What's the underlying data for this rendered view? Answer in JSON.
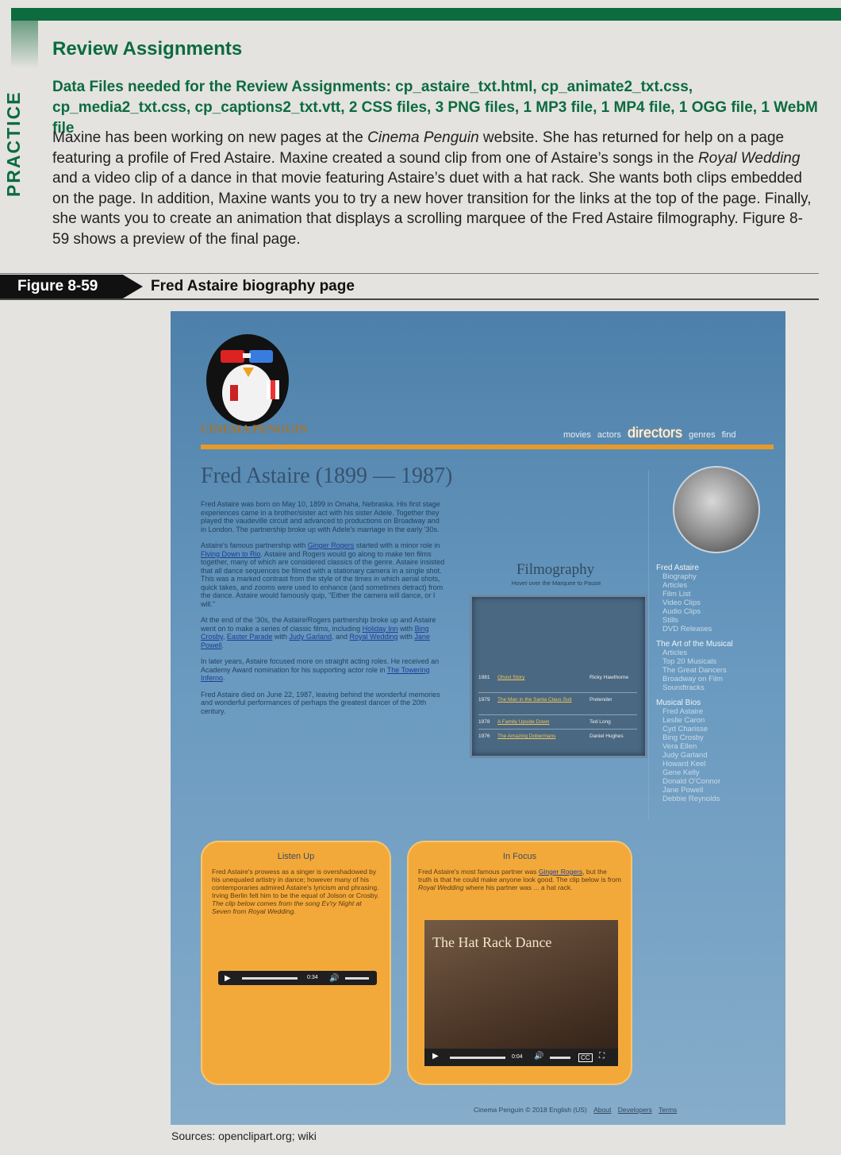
{
  "book": {
    "side_tab": "PRACTICE",
    "title": "Review Assignments",
    "data_files": "Data Files needed for the Review Assignments: cp_astaire_txt.html, cp_animate2_txt.css, cp_media2_txt.css, cp_captions2_txt.vtt, 2 CSS files, 3 PNG files, 1 MP3 file, 1 MP4 file, 1 OGG file, 1 WebM file",
    "para": {
      "p1": "Maxine has been working on new pages at the ",
      "cinema": "Cinema Penguin",
      "p2": " website. She has returned for help on a page featuring a profile of Fred Astaire. Maxine created a sound clip from one of Astaire’s songs in the ",
      "royal": "Royal Wedding",
      "p3": " and a video clip of a dance in that movie featuring Astaire’s duet with a hat rack. She wants both clips embedded on the page. In addition, Maxine wants you to try a new hover transition for the links at the top of the page. Finally, she wants you to create an animation that displays a scrolling marquee of the Fred Astaire filmography. Figure 8-59 shows a preview of the final page."
    },
    "figure_label": "Figure 8-59",
    "figure_caption": "Fred Astaire biography page",
    "sources": "Sources: openclipart.org; wiki"
  },
  "site": {
    "logo_text": "CINEMA PENGUIN",
    "nav": [
      "movies",
      "actors",
      "directors",
      "genres",
      "find"
    ],
    "bio_title": "Fred Astaire (1899 — 1987)",
    "bio": {
      "p1": "Fred Astaire was born on May 10, 1899 in Omaha, Nebraska. His first stage experiences came in a brother/sister act with his sister Adele. Together they played the vaudeville circuit and advanced to productions on Broadway and in London. The partnership broke up with Adele's marriage in the early '30s.",
      "p2a": "Astaire's famous partnership with ",
      "p2_link1": "Ginger Rogers",
      "p2b": " started with a minor role in ",
      "p2_link2": "Flying Down to Rio",
      "p2c": ". Astaire and Rogers would go along to make ten films together, many of which are considered classics of the genre. Astaire insisted that all dance sequences be filmed with a stationary camera in a single shot. This was a marked contrast from the style of the times in which aerial shots, quick takes, and zooms were used to enhance (and sometimes detract) from the dance. Astaire would famously quip, \"Either the camera will dance, or I will.\"",
      "p3a": "At the end of the '30s, the Astaire/Rogers partnership broke up and Astaire went on to make a series of classic films, including ",
      "p3_link1": "Holiday Inn",
      "p3b": " with ",
      "p3_link2": "Bing Crosby",
      "p3c": ", ",
      "p3_link3": "Easter Parade",
      "p3d": " with ",
      "p3_link4": "Judy Garland",
      "p3e": ", and ",
      "p3_link5": "Royal Wedding",
      "p3f": " with ",
      "p3_link6": "Jane Powell",
      "p3g": ".",
      "p4a": "In later years, Astaire focused more on straight acting roles. He received an Academy Award nomination for his supporting actor role in ",
      "p4_link": "The Towering Inferno",
      "p4b": ".",
      "p5": "Fred Astaire died on June 22, 1987, leaving behind the wonderful memories and wonderful performances of perhaps the greatest dancer of the 20th century."
    },
    "filmography": {
      "title": "Filmography",
      "subtitle": "Hover over the Marquee to Pause",
      "rows": [
        {
          "year": "1981",
          "title": "Ghost Story",
          "role": "Ricky Hawthorne"
        },
        {
          "year": "1979",
          "title": "The Man in the Santa Claus Suit",
          "role": "Pretender"
        },
        {
          "year": "1978",
          "title": "A Family Upside Down",
          "role": "Ted Long"
        },
        {
          "year": "1976",
          "title": "The Amazing Dobermans",
          "role": "Daniel Hughes"
        }
      ]
    },
    "sidebar": {
      "name": "Fred Astaire",
      "group1": [
        "Biography",
        "Articles",
        "Film List",
        "Video Clips",
        "Audio Clips",
        "Stills",
        "DVD Releases"
      ],
      "heading2": "The Art of the Musical",
      "group2": [
        "Articles",
        "Top 20 Musicals",
        "The Great Dancers",
        "Broadway on Film",
        "Soundtracks"
      ],
      "heading3": "Musical Bios",
      "group3": [
        "Fred Astaire",
        "Leslie Caron",
        "Cyd Charisse",
        "Bing Crosby",
        "Vera Ellen",
        "Judy Garland",
        "Howard Keel",
        "Gene Kelly",
        "Donald O'Connor",
        "Jane Powell",
        "Debbie Reynolds"
      ]
    },
    "listen_up": {
      "title": "Listen Up",
      "text": "Fred Astaire's prowess as a singer is overshadowed by his unequaled artistry in dance; however many of his contemporaries admired Astaire's lyricism and phrasing. Irving Berlin felt him to be the equal of Jolson or Crosby.",
      "text2": "The clip below comes from the song Ev'ry Night at Seven from Royal Wedding.",
      "time": "0:34"
    },
    "in_focus": {
      "title": "In Focus",
      "text_a": "Fred Astaire's most famous partner was ",
      "text_link": "Ginger Rogers",
      "text_b": ", but the truth is that he could make anyone look good. The clip below is from ",
      "text_c": "Royal Wedding",
      "text_d": " where his partner was ... a hat rack.",
      "video_title": "The Hat Rack Dance",
      "time": "0:04"
    },
    "footer": {
      "copyright": "Cinema Penguin © 2018 English (US)",
      "links": [
        "About",
        "Developers",
        "Terms"
      ]
    }
  }
}
